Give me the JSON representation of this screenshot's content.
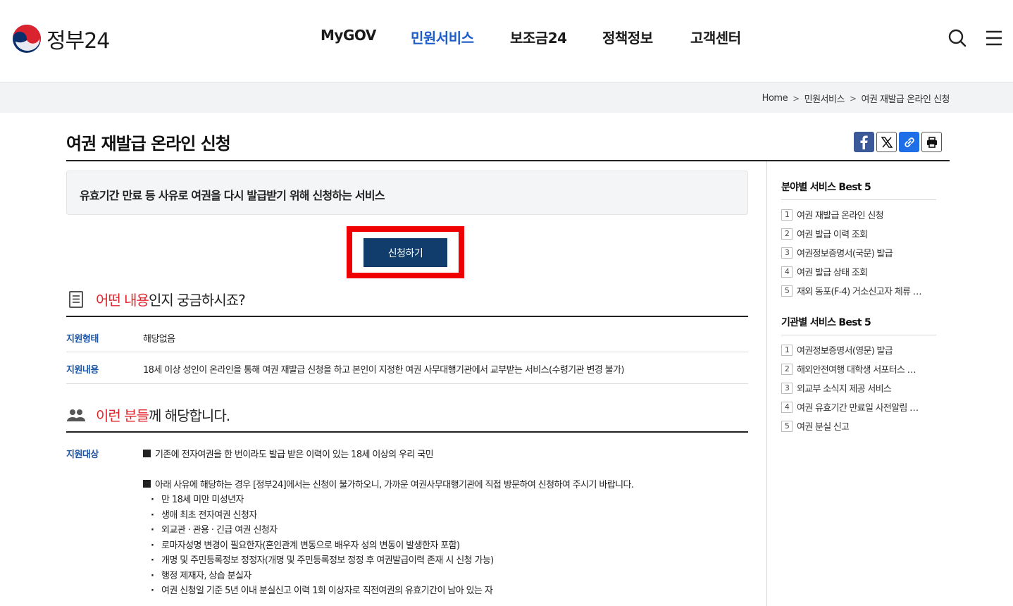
{
  "header": {
    "logo_text": "정부24",
    "nav": [
      "MyGOV",
      "민원서비스",
      "보조금24",
      "정책정보",
      "고객센터"
    ],
    "active_nav": "민원서비스"
  },
  "breadcrumb": [
    "Home",
    "민원서비스",
    "여권 재발급 온라인 신청"
  ],
  "page": {
    "title": "여권 재발급 온라인 신청",
    "summary": "유효기간 만료 등 사유로 여권을 다시 발급받기 위해 신청하는 서비스",
    "apply_label": "신청하기"
  },
  "section1": {
    "heading_red": "어떤 내용",
    "heading_rest": "인지 궁금하시죠?",
    "rows": [
      {
        "label": "지원형태",
        "value": "해당없음"
      },
      {
        "label": "지원내용",
        "value": "18세 이상 성인이 온라인을 통해 여권 재발급 신청을 하고 본인이 지정한 여권 사무대행기관에서 교부받는 서비스(수령기관 변경 불가)"
      }
    ]
  },
  "section2": {
    "heading_red": "이런 분들",
    "heading_rest": "께 해당합니다.",
    "label": "지원대상",
    "item1": "기존에 전자여권을 한 번이라도 발급 받은 이력이 있는 18세 이상의 우리 국민",
    "item2": "아래 사유에 해당하는 경우 [정부24]에서는 신청이 불가하오니, 가까운 여권사무대행기관에 직접 방문하여 신청하여 주시기 바랍니다.",
    "bullets": [
      "만 18세 미만 미성년자",
      "생애 최초 전자여권 신청자",
      "외교관 · 관용 · 긴급 여권 신청자",
      "로마자성명 변경이 필요한자(혼인관계 변동으로 배우자 성의 변동이 발생한자 포함)",
      "개명 및 주민등록정보 정정자(개명 및 주민등록정보 정정 후 여권발급이력 존재 시 신청 가능)",
      "행정 제재자, 상습 분실자",
      "여권 신청일 기준 5년 이내 분실신고 이력 1회 이상자로 직전여권의 유효기간이 남아 있는 자"
    ]
  },
  "sidebar": {
    "best1_title": "분야별 서비스 Best 5",
    "best1": [
      "여권 재발급 온라인 신청",
      "여권 발급 이력 조회",
      "여권정보증명서(국문) 발급",
      "여권 발급 상태 조회",
      "재외 동포(F-4) 거소신고자 체류 …"
    ],
    "best2_title": "기관별 서비스 Best 5",
    "best2": [
      "여권정보증명서(영문) 발급",
      "해외안전여행 대학생 서포터스 …",
      "외교부 소식지 제공 서비스",
      "여권 유효기간 만료일 사전알림 …",
      "여권 분실 신고"
    ],
    "numbers": [
      "1",
      "2",
      "3",
      "4",
      "5"
    ]
  }
}
